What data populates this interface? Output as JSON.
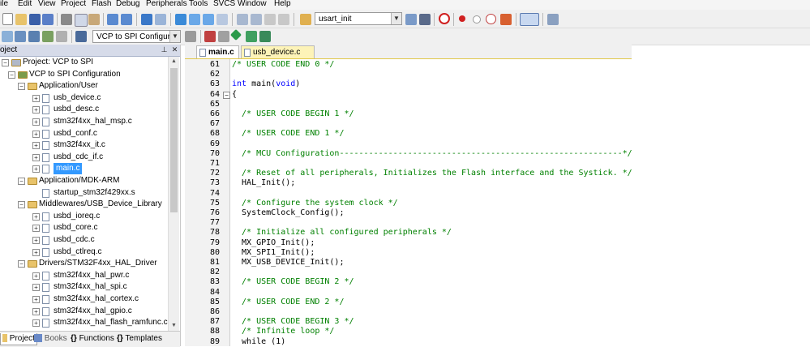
{
  "menu": [
    "ile",
    "Edit",
    "View",
    "Project",
    "Flash",
    "Debug",
    "Peripherals",
    "Tools",
    "SVCS",
    "Window",
    "Help"
  ],
  "toolbar1": {
    "find_combo_value": "usart_init"
  },
  "toolbar2": {
    "target_combo_value": "VCP to SPI Configuration"
  },
  "project_panel": {
    "title": "oject",
    "tree": [
      {
        "label": "Project: VCP to SPI",
        "level": 0,
        "kind": "project",
        "expander": "−"
      },
      {
        "label": "VCP to SPI Configuration",
        "level": 1,
        "kind": "target",
        "expander": "−"
      },
      {
        "label": "Application/User",
        "level": 2,
        "kind": "folder",
        "expander": "−"
      },
      {
        "label": "usb_device.c",
        "level": 3,
        "kind": "file",
        "expander": "+"
      },
      {
        "label": "usbd_desc.c",
        "level": 3,
        "kind": "file",
        "expander": "+"
      },
      {
        "label": "stm32f4xx_hal_msp.c",
        "level": 3,
        "kind": "file",
        "expander": "+"
      },
      {
        "label": "usbd_conf.c",
        "level": 3,
        "kind": "file",
        "expander": "+"
      },
      {
        "label": "stm32f4xx_it.c",
        "level": 3,
        "kind": "file",
        "expander": "+"
      },
      {
        "label": "usbd_cdc_if.c",
        "level": 3,
        "kind": "file",
        "expander": "+"
      },
      {
        "label": "main.c",
        "level": 3,
        "kind": "file",
        "expander": "+",
        "selected": true
      },
      {
        "label": "Application/MDK-ARM",
        "level": 2,
        "kind": "folder",
        "expander": "−"
      },
      {
        "label": "startup_stm32f429xx.s",
        "level": 3,
        "kind": "file",
        "expander": ""
      },
      {
        "label": "Middlewares/USB_Device_Library",
        "level": 2,
        "kind": "folder",
        "expander": "−"
      },
      {
        "label": "usbd_ioreq.c",
        "level": 3,
        "kind": "file",
        "expander": "+"
      },
      {
        "label": "usbd_core.c",
        "level": 3,
        "kind": "file",
        "expander": "+"
      },
      {
        "label": "usbd_cdc.c",
        "level": 3,
        "kind": "file",
        "expander": "+"
      },
      {
        "label": "usbd_ctlreq.c",
        "level": 3,
        "kind": "file",
        "expander": "+"
      },
      {
        "label": "Drivers/STM32F4xx_HAL_Driver",
        "level": 2,
        "kind": "folder",
        "expander": "−"
      },
      {
        "label": "stm32f4xx_hal_pwr.c",
        "level": 3,
        "kind": "file",
        "expander": "+"
      },
      {
        "label": "stm32f4xx_hal_spi.c",
        "level": 3,
        "kind": "file",
        "expander": "+"
      },
      {
        "label": "stm32f4xx_hal_cortex.c",
        "level": 3,
        "kind": "file",
        "expander": "+"
      },
      {
        "label": "stm32f4xx_hal_gpio.c",
        "level": 3,
        "kind": "file",
        "expander": "+"
      },
      {
        "label": "stm32f4xx_hal_flash_ramfunc.c",
        "level": 3,
        "kind": "file",
        "expander": "+"
      }
    ],
    "bottom_tabs": [
      "Project",
      "Books",
      "Functions",
      "Templates"
    ],
    "bottom_tab_glyphs": [
      "",
      "",
      "{}",
      "{}"
    ]
  },
  "editor": {
    "tabs": [
      "main.c",
      "usb_device.c"
    ],
    "lines": [
      {
        "n": "61",
        "text": "/* USER CODE END 0 */",
        "style": "comment"
      },
      {
        "n": "62",
        "text": "",
        "style": "plain"
      },
      {
        "n": "63",
        "text": "int main(void)",
        "style": "main"
      },
      {
        "n": "64",
        "text": "{",
        "style": "plain",
        "fold": "−"
      },
      {
        "n": "65",
        "text": "",
        "style": "plain"
      },
      {
        "n": "66",
        "text": "  /* USER CODE BEGIN 1 */",
        "style": "comment"
      },
      {
        "n": "67",
        "text": "",
        "style": "plain"
      },
      {
        "n": "68",
        "text": "  /* USER CODE END 1 */",
        "style": "comment"
      },
      {
        "n": "69",
        "text": "",
        "style": "plain"
      },
      {
        "n": "70",
        "text": "  /* MCU Configuration----------------------------------------------------------*/",
        "style": "comment"
      },
      {
        "n": "71",
        "text": "",
        "style": "plain"
      },
      {
        "n": "72",
        "text": "  /* Reset of all peripherals, Initializes the Flash interface and the Systick. */",
        "style": "comment"
      },
      {
        "n": "73",
        "text": "  HAL_Init();",
        "style": "plain"
      },
      {
        "n": "74",
        "text": "",
        "style": "plain"
      },
      {
        "n": "75",
        "text": "  /* Configure the system clock */",
        "style": "comment"
      },
      {
        "n": "76",
        "text": "  SystemClock_Config();",
        "style": "plain"
      },
      {
        "n": "77",
        "text": "",
        "style": "plain"
      },
      {
        "n": "78",
        "text": "  /* Initialize all configured peripherals */",
        "style": "comment"
      },
      {
        "n": "79",
        "text": "  MX_GPIO_Init();",
        "style": "plain"
      },
      {
        "n": "80",
        "text": "  MX_SPI1_Init();",
        "style": "plain"
      },
      {
        "n": "81",
        "text": "  MX_USB_DEVICE_Init();",
        "style": "plain"
      },
      {
        "n": "82",
        "text": "",
        "style": "plain"
      },
      {
        "n": "83",
        "text": "  /* USER CODE BEGIN 2 */",
        "style": "comment"
      },
      {
        "n": "84",
        "text": "",
        "style": "plain"
      },
      {
        "n": "85",
        "text": "  /* USER CODE END 2 */",
        "style": "comment"
      },
      {
        "n": "86",
        "text": "",
        "style": "plain"
      },
      {
        "n": "87",
        "text": "  /* USER CODE BEGIN 3 */",
        "style": "comment"
      },
      {
        "n": "88",
        "text": "  /* Infinite loop */",
        "style": "comment"
      },
      {
        "n": "89",
        "text": "  while (1)",
        "style": "plain"
      }
    ]
  },
  "colors": {
    "comment": "#008000",
    "keyword": "#0000ff",
    "selection": "#3399ff",
    "active_file_tab": "#fdf3b8"
  }
}
